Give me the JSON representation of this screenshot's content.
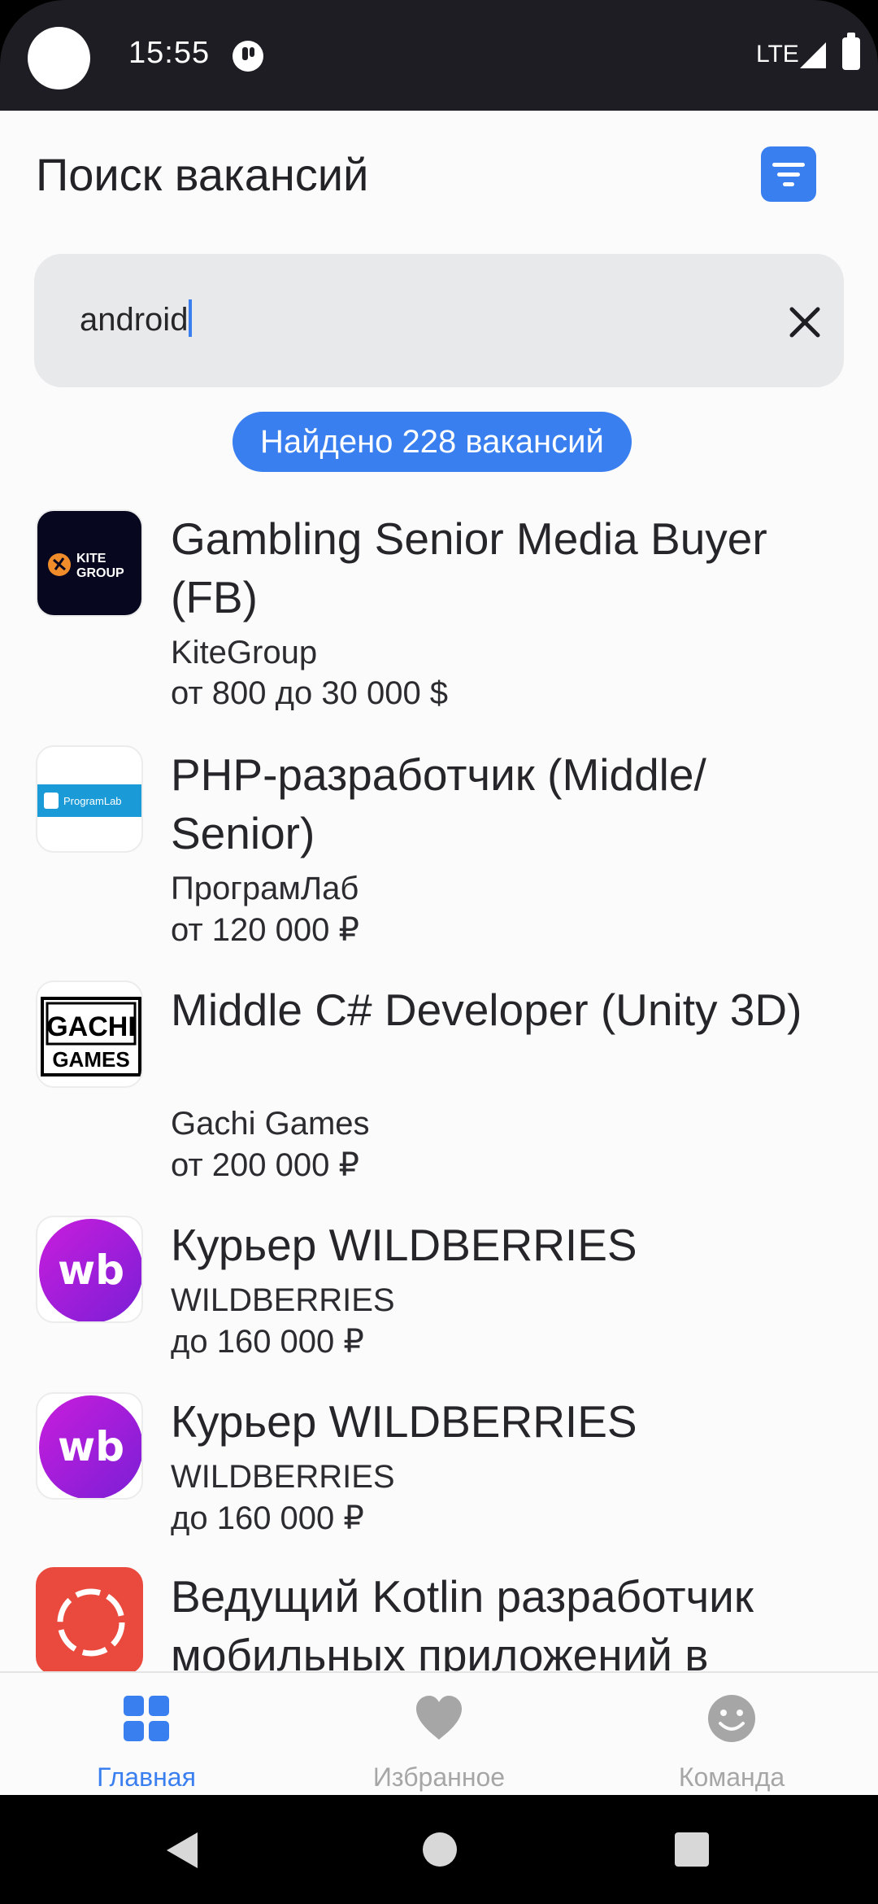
{
  "status_bar": {
    "time": "15:55",
    "network": "LTE"
  },
  "header": {
    "title": "Поиск вакансий"
  },
  "search": {
    "value": "android"
  },
  "results": {
    "found_label": "Найдено 228 вакансий"
  },
  "vacancies": [
    {
      "title": "Gambling Senior Media Buyer (FB)",
      "company": "KiteGroup",
      "salary": "от 800 до 30 000 $",
      "logo_text": [
        "KITE",
        "GROUP"
      ]
    },
    {
      "title": "PHP-разработчик (Middle/ Senior)",
      "company": "ПрограмЛаб",
      "salary": "от 120 000 ₽",
      "logo_text": "ProgramLab"
    },
    {
      "title": "Middle C# Developer (Unity 3D)",
      "company": "Gachi Games",
      "salary": "от 200 000 ₽",
      "logo_text": [
        "GACHI",
        "GAMES"
      ]
    },
    {
      "title": "Курьер WILDBERRIES",
      "company": "WILDBERRIES",
      "salary": "до 160 000 ₽",
      "logo_text": "wb"
    },
    {
      "title": "Курьер WILDBERRIES",
      "company": "WILDBERRIES",
      "salary": "до 160 000 ₽",
      "logo_text": "wb"
    },
    {
      "title": "Ведущий Kotlin разработчик мобильных приложений в",
      "company": "",
      "salary": ""
    }
  ],
  "bottom_nav": [
    {
      "label": "Главная",
      "icon": "grid-icon",
      "active": true
    },
    {
      "label": "Избранное",
      "icon": "heart-icon",
      "active": false
    },
    {
      "label": "Команда",
      "icon": "smiley-icon",
      "active": false
    }
  ],
  "colors": {
    "accent": "#3a7ff0",
    "inactive": "#a6a6a6",
    "background": "#fbfbfb"
  }
}
